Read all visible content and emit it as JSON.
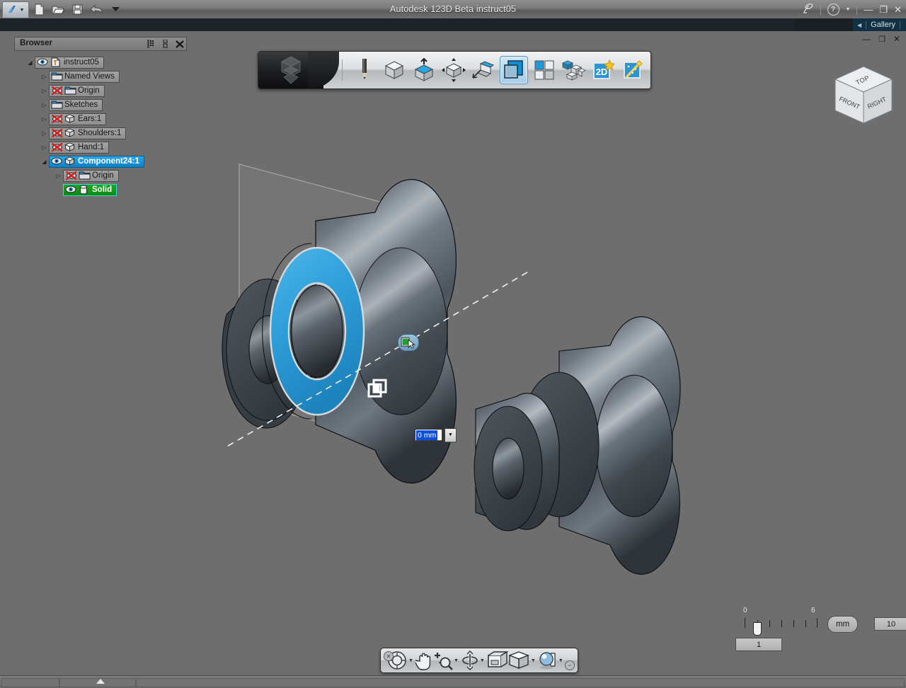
{
  "window": {
    "title": "Autodesk 123D Beta    instruct05",
    "app_name": "Autodesk 123D Beta",
    "document_name": "instruct05",
    "app_button_icon": "autodesk-logo-icon",
    "quick_access": [
      {
        "name": "new-document-button",
        "icon": "new-file-icon",
        "label": "New"
      },
      {
        "name": "open-document-button",
        "icon": "open-folder-icon",
        "label": "Open"
      },
      {
        "name": "save-document-button",
        "icon": "floppy-disk-icon",
        "label": "Save"
      },
      {
        "name": "undo-button",
        "icon": "undo-arrow-icon",
        "label": "Undo"
      },
      {
        "name": "qat-overflow-button",
        "icon": "chevron-down-icon",
        "label": "Customize"
      }
    ],
    "controls": {
      "share_icon": "satellite-dish-icon",
      "help_label": "?",
      "help_dropdown_icon": "chevron-down-icon",
      "minimize_label": "—",
      "maximize_label": "❐",
      "close_label": "✕"
    }
  },
  "tabstrip": {
    "collapse_arrow": "◀",
    "gallery_label": "Gallery"
  },
  "document_controls": {
    "minimize_label": "—",
    "restore_label": "❐",
    "close_label": "✕"
  },
  "browser": {
    "title": "Browser",
    "header_buttons": [
      {
        "name": "browser-filter-button",
        "icon": "grid-list-icon"
      },
      {
        "name": "browser-menu-button",
        "icon": "vertical-dots-icon"
      },
      {
        "name": "browser-close-button",
        "icon": "close-x-icon"
      }
    ],
    "tree": [
      {
        "label": "instruct05",
        "indent": 0,
        "twisty": "◢",
        "icons": [
          "eye-visible-icon",
          "pin-document-icon"
        ],
        "state": "normal"
      },
      {
        "label": "Named Views",
        "indent": 1,
        "twisty": "▷",
        "icons": [
          "folder-icon"
        ],
        "state": "normal"
      },
      {
        "label": "Origin",
        "indent": 1,
        "twisty": "▷",
        "icons": [
          "eye-hidden-icon",
          "folder-icon"
        ],
        "state": "normal"
      },
      {
        "label": "Sketches",
        "indent": 1,
        "twisty": "▷",
        "icons": [
          "folder-icon"
        ],
        "state": "normal"
      },
      {
        "label": "Ears:1",
        "indent": 1,
        "twisty": "▷",
        "icons": [
          "eye-hidden-icon",
          "component-cube-icon"
        ],
        "state": "normal"
      },
      {
        "label": "Shoulders:1",
        "indent": 1,
        "twisty": "▷",
        "icons": [
          "eye-hidden-icon",
          "component-cube-icon"
        ],
        "state": "normal"
      },
      {
        "label": "Hand:1",
        "indent": 1,
        "twisty": "▷",
        "icons": [
          "eye-hidden-icon",
          "component-cube-icon"
        ],
        "state": "normal"
      },
      {
        "label": "Component24:1",
        "indent": 1,
        "twisty": "◢",
        "icons": [
          "eye-visible-icon",
          "component-cube-icon"
        ],
        "state": "selected"
      },
      {
        "label": "Origin",
        "indent": 2,
        "twisty": "▷",
        "icons": [
          "eye-hidden-icon",
          "folder-icon"
        ],
        "state": "normal"
      },
      {
        "label": "Solid",
        "indent": 2,
        "twisty": "",
        "icons": [
          "eye-visible-icon",
          "solid-body-icon"
        ],
        "state": "active"
      }
    ]
  },
  "toolbar": {
    "logo_icon": "cube-logo-icon",
    "buttons": [
      {
        "name": "sketch-tool-button",
        "icon": "pencil-icon",
        "label": "Sketch",
        "active": false
      },
      {
        "name": "primitive-tool-button",
        "icon": "cube-primitive-icon",
        "label": "Primitives",
        "active": false
      },
      {
        "name": "construct-tool-button",
        "icon": "extrude-cube-icon",
        "label": "Construct",
        "active": false
      },
      {
        "name": "modify-tool-button",
        "icon": "modify-arrows-icon",
        "label": "Modify",
        "active": false
      },
      {
        "name": "pattern-tool-button",
        "icon": "chamfer-cube-icon",
        "label": "Pattern",
        "active": false
      },
      {
        "name": "combine-tool-button",
        "icon": "combine-squares-icon",
        "label": "Combine",
        "active": true
      },
      {
        "name": "grid-tool-button",
        "icon": "four-squares-icon",
        "label": "Grid",
        "active": false
      },
      {
        "name": "assemble-tool-button",
        "icon": "blocks-assembly-icon",
        "label": "Assemble",
        "active": false
      },
      {
        "name": "drawing-tool-button",
        "icon": "2d-drawing-star-icon",
        "label": "2D",
        "active": false
      },
      {
        "name": "effects-tool-button",
        "icon": "magic-wand-icon",
        "label": "Effects",
        "active": false
      }
    ],
    "end_cap": "toolbar-end-cap"
  },
  "viewcube": {
    "top_label": "TOP",
    "front_label": "FRONT",
    "right_label": "RIGHT"
  },
  "value_input": {
    "value": "0 mm",
    "dropdown_icon": "▼"
  },
  "canvas": {
    "selected_face_color": "#2fa2dd",
    "body_color": "#56606a",
    "background_color": "#6e6e6e",
    "workplane_label": "work-plane",
    "axis_label": "center-axis",
    "badge_icon": "face-select-cursor-icon",
    "mate_glyph_icon": "mate-constraint-icon"
  },
  "scale_widget": {
    "min_tick_label": "0",
    "max_tick_label": "6",
    "current_value": "1",
    "unit_label": "mm",
    "max_value": "10"
  },
  "navbar": {
    "close_icon": "✕",
    "minimize_icon": "−",
    "buttons": [
      {
        "name": "steering-wheel-button",
        "icon": "steering-wheel-icon",
        "label": "Full Navigation Wheel",
        "caret": true
      },
      {
        "name": "pan-button",
        "icon": "pan-hand-icon",
        "label": "Pan",
        "caret": false
      },
      {
        "name": "zoom-button",
        "icon": "zoom-magnifier-icon",
        "label": "Zoom",
        "caret": true
      },
      {
        "name": "orbit-button",
        "icon": "orbit-icon",
        "label": "Orbit",
        "caret": true
      },
      {
        "name": "look-at-button",
        "icon": "look-at-icon",
        "label": "Look At",
        "caret": false
      },
      {
        "name": "view-style-button",
        "icon": "view-cube-icon",
        "label": "Visual Style",
        "caret": true
      },
      {
        "name": "appearance-button",
        "icon": "sphere-shade-icon",
        "label": "Appearance",
        "caret": true
      }
    ]
  }
}
